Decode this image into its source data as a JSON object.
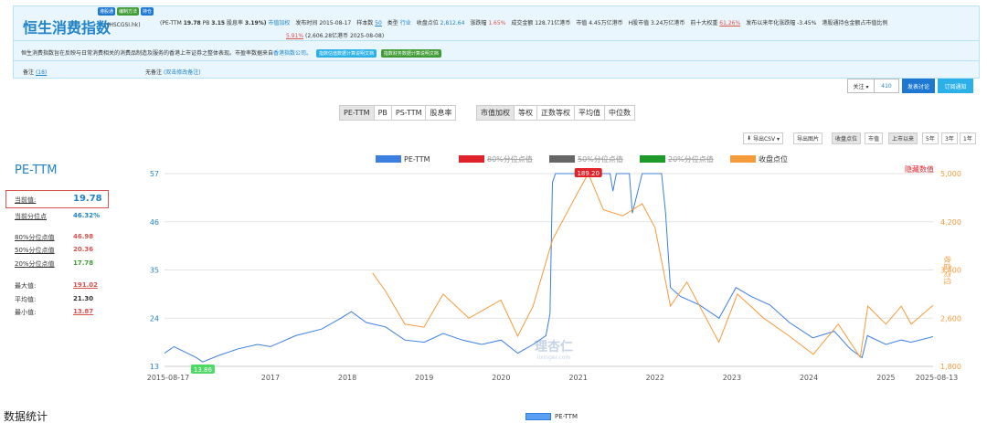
{
  "header": {
    "title": "恒生消费指数",
    "code": "(HSCGSI.hk)",
    "badges": [
      "港股通",
      "编制方法",
      "持仓"
    ],
    "metrics": {
      "pe_label": "(PE-TTM",
      "pe_value": "19.78",
      "pb_label": "PB",
      "pb_value": "3.15",
      "dy_label": "股息率",
      "dy_value": "3.19%)",
      "dy_link": "市值加权",
      "publish": "发布时间 2015-08-17",
      "samples_label": "样本数",
      "samples_value": "50",
      "type_label": "类型",
      "type_value": "行业",
      "close_label": "收盘点位",
      "close_value": "2,812.64",
      "change_label": "涨跌幅",
      "change_value": "1.65%",
      "volume": "成交金额 128.71亿港币",
      "mcap": "市值 4.45万亿港币",
      "hmcap": "H股市值 3.24万亿港币",
      "top10_label": "前十大权重",
      "top10_value": "61.26%",
      "annual": "发布以来年化涨跌幅 -3.45%",
      "holding": "港股通持仓金额占市值比例"
    },
    "metrics2": {
      "value": "5.91%",
      "rest": "(2,606.28亿港币  2025-08-08)"
    },
    "description": "恒生消费指数旨在反映与日常消费相关的消费品制造及服务的香港上市证券之整体表现。市盈率数据来自",
    "desc_link": "香港指数公司。",
    "desc_btn1": "指数估值数据计算说明文档",
    "desc_btn2": "指数财务数据计算说明文档",
    "note_label": "备注",
    "note_count": "(18)",
    "note_none": "无备注",
    "note_link": "(双击修改备注)"
  },
  "follow": {
    "label": "关注 ▾",
    "count": "410",
    "discuss": "发表讨论",
    "subscribe": "订阅通知"
  },
  "tabs_metric": [
    "PE-TTM",
    "PB",
    "PS-TTM",
    "股息率"
  ],
  "tabs_weight": [
    "市值加权",
    "等权",
    "正数等权",
    "平均值",
    "中位数"
  ],
  "controls": {
    "export_csv": "导出CSV ▾",
    "export_img": "导出图片",
    "close_point": "收盘点位",
    "mcap": "市值",
    "periods": [
      "上市以来",
      "5年",
      "3年",
      "1年"
    ]
  },
  "side": {
    "title": "PE-TTM",
    "rows": [
      {
        "label": "当前值:",
        "value": "19.78"
      },
      {
        "label": "当前分位点",
        "value": "46.32%"
      },
      {
        "label": "80%分位点值",
        "value": "46.98"
      },
      {
        "label": "50%分位点值",
        "value": "20.36"
      },
      {
        "label": "20%分位点值",
        "value": "17.78"
      },
      {
        "label": "最大值:",
        "value": "191.02"
      },
      {
        "label": "平均值:",
        "value": "21.30"
      },
      {
        "label": "最小值:",
        "value": "13.87"
      }
    ]
  },
  "stats_title": "数据统计",
  "bottom_legend": "PE-TTM",
  "colors": {
    "pe": "#3d7fe0",
    "p80": "#e0232b",
    "p50": "#666666",
    "p20": "#1e9a2a",
    "close": "#f59b3a",
    "accent": "#2283c8"
  },
  "chart_data": {
    "type": "line",
    "legend": [
      {
        "name": "PE-TTM",
        "color": "#3d7fe0",
        "struck": false
      },
      {
        "name": "80%分位点值",
        "color": "#e0232b",
        "struck": true
      },
      {
        "name": "50%分位点值",
        "color": "#666666",
        "struck": true
      },
      {
        "name": "20%分位点值",
        "color": "#1e9a2a",
        "struck": true
      },
      {
        "name": "收盘点位",
        "color": "#f59b3a",
        "struck": false
      }
    ],
    "hide_label": "隐藏数值",
    "right_axis_label": "收盘点位",
    "x_ticks": [
      "2015-08-17",
      "2017",
      "2018",
      "2019",
      "2020",
      "2021",
      "2022",
      "2023",
      "2024",
      "2025",
      "2025-08-13"
    ],
    "x_range": [
      "2015-08-17",
      "2025-08-13"
    ],
    "y_left": {
      "ticks": [
        13,
        24,
        35,
        46,
        57
      ],
      "range": [
        13,
        57
      ]
    },
    "y_right": {
      "ticks": [
        "1,800",
        "2,600",
        "3,400",
        "4,200",
        "5,000"
      ],
      "range": [
        1800,
        5000
      ]
    },
    "max_label": "189.20",
    "min_label": "13.86",
    "watermark": [
      "理杏仁",
      "lixinger.com"
    ],
    "series": [
      {
        "name": "PE-TTM",
        "points": [
          [
            "2015-08-17",
            16
          ],
          [
            "2015-10-01",
            17.5
          ],
          [
            "2016-01-15",
            15
          ],
          [
            "2016-02-15",
            14
          ],
          [
            "2016-05-01",
            15.5
          ],
          [
            "2016-08-01",
            17
          ],
          [
            "2016-11-01",
            18
          ],
          [
            "2017-01-01",
            17.5
          ],
          [
            "2017-05-01",
            20
          ],
          [
            "2017-09-01",
            21.5
          ],
          [
            "2017-12-01",
            24
          ],
          [
            "2018-01-20",
            25.5
          ],
          [
            "2018-04-01",
            23
          ],
          [
            "2018-07-01",
            22
          ],
          [
            "2018-10-01",
            19
          ],
          [
            "2019-01-01",
            18.5
          ],
          [
            "2019-04-01",
            20.5
          ],
          [
            "2019-07-01",
            19
          ],
          [
            "2019-10-01",
            18
          ],
          [
            "2020-01-01",
            19
          ],
          [
            "2020-03-20",
            16
          ],
          [
            "2020-06-01",
            18
          ],
          [
            "2020-08-01",
            20
          ],
          [
            "2020-08-20",
            25
          ],
          [
            "2020-09-01",
            55
          ],
          [
            "2020-09-15",
            57
          ],
          [
            "2021-06-01",
            57
          ],
          [
            "2021-06-15",
            53
          ],
          [
            "2021-07-01",
            57
          ],
          [
            "2021-09-01",
            57
          ],
          [
            "2021-09-15",
            48
          ],
          [
            "2021-10-01",
            51
          ],
          [
            "2021-11-01",
            57
          ],
          [
            "2022-02-01",
            57
          ],
          [
            "2022-02-20",
            48
          ],
          [
            "2022-03-15",
            31
          ],
          [
            "2022-05-01",
            29
          ],
          [
            "2022-08-01",
            27
          ],
          [
            "2022-11-01",
            24
          ],
          [
            "2023-01-20",
            31
          ],
          [
            "2023-04-01",
            29
          ],
          [
            "2023-07-01",
            27
          ],
          [
            "2023-10-01",
            23
          ],
          [
            "2024-01-20",
            19.5
          ],
          [
            "2024-05-01",
            21
          ],
          [
            "2024-07-15",
            17
          ],
          [
            "2024-09-10",
            15
          ],
          [
            "2024-10-05",
            20
          ],
          [
            "2025-01-01",
            18
          ],
          [
            "2025-03-15",
            19
          ],
          [
            "2025-05-01",
            18.5
          ],
          [
            "2025-08-13",
            19.78
          ]
        ]
      },
      {
        "name": "收盘点位",
        "points": [
          [
            "2018-05-01",
            3350
          ],
          [
            "2018-07-01",
            3050
          ],
          [
            "2018-10-01",
            2500
          ],
          [
            "2018-12-31",
            2450
          ],
          [
            "2019-04-01",
            3000
          ],
          [
            "2019-08-01",
            2600
          ],
          [
            "2019-12-31",
            2900
          ],
          [
            "2020-03-20",
            2300
          ],
          [
            "2020-06-01",
            2800
          ],
          [
            "2020-09-01",
            3900
          ],
          [
            "2021-01-01",
            4700
          ],
          [
            "2021-02-18",
            5000
          ],
          [
            "2021-05-01",
            4400
          ],
          [
            "2021-08-01",
            4300
          ],
          [
            "2021-11-01",
            4500
          ],
          [
            "2022-01-01",
            4100
          ],
          [
            "2022-03-15",
            2800
          ],
          [
            "2022-06-01",
            3200
          ],
          [
            "2022-10-31",
            2200
          ],
          [
            "2023-01-27",
            3000
          ],
          [
            "2023-06-01",
            2600
          ],
          [
            "2023-10-01",
            2300
          ],
          [
            "2024-01-22",
            2000
          ],
          [
            "2024-05-20",
            2500
          ],
          [
            "2024-09-01",
            1950
          ],
          [
            "2024-10-07",
            2800
          ],
          [
            "2025-01-01",
            2500
          ],
          [
            "2025-03-15",
            2800
          ],
          [
            "2025-05-01",
            2500
          ],
          [
            "2025-08-13",
            2812.64
          ]
        ]
      }
    ]
  }
}
